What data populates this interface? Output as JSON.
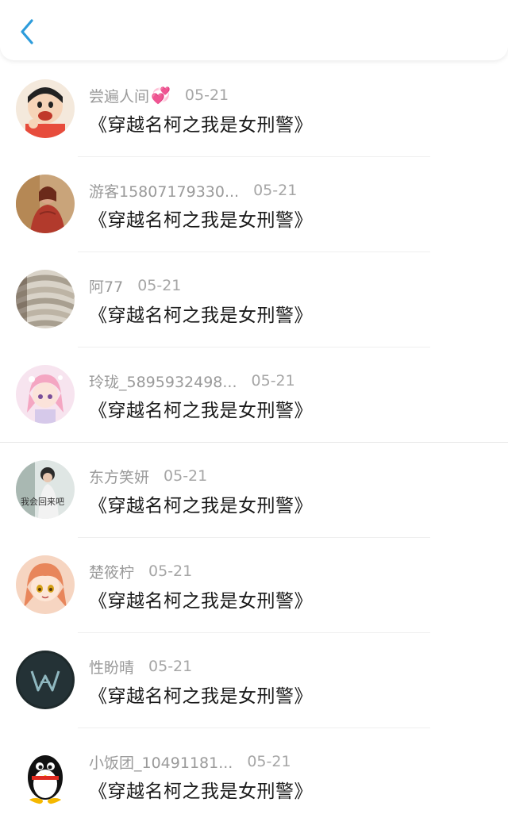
{
  "header": {
    "back_icon": "chevron-left-icon",
    "accent_color": "#2d9cdb"
  },
  "comments": [
    {
      "username": "尝遍人间",
      "emoji": "💞",
      "date": "05-21",
      "message": "《穿越名柯之我是女刑警》",
      "avatar": "cartoon-avatar"
    },
    {
      "username": "游客15807179330...",
      "date": "05-21",
      "message": "《穿越名柯之我是女刑警》",
      "avatar": "portrait-avatar"
    },
    {
      "username": "阿77",
      "date": "05-21",
      "message": "《穿越名柯之我是女刑警》",
      "avatar": "knit-avatar"
    },
    {
      "username": "玲珑_5895932498...",
      "date": "05-21",
      "message": "《穿越名柯之我是女刑警》",
      "avatar": "anime-avatar"
    },
    {
      "username": "东方笑妍",
      "date": "05-21",
      "message": "《穿越名柯之我是女刑警》",
      "avatar": "girl-photo-avatar",
      "avatar_text": "我会回来吧"
    },
    {
      "username": "楚筱柠",
      "date": "05-21",
      "message": "《穿越名柯之我是女刑警》",
      "avatar": "anime-girl-avatar"
    },
    {
      "username": "性盼晴",
      "date": "05-21",
      "message": "《穿越名柯之我是女刑警》",
      "avatar": "logo-avatar"
    },
    {
      "username": "小饭团_10491181...",
      "date": "05-21",
      "message": "《穿越名柯之我是女刑警》",
      "avatar": "penguin-avatar"
    }
  ]
}
